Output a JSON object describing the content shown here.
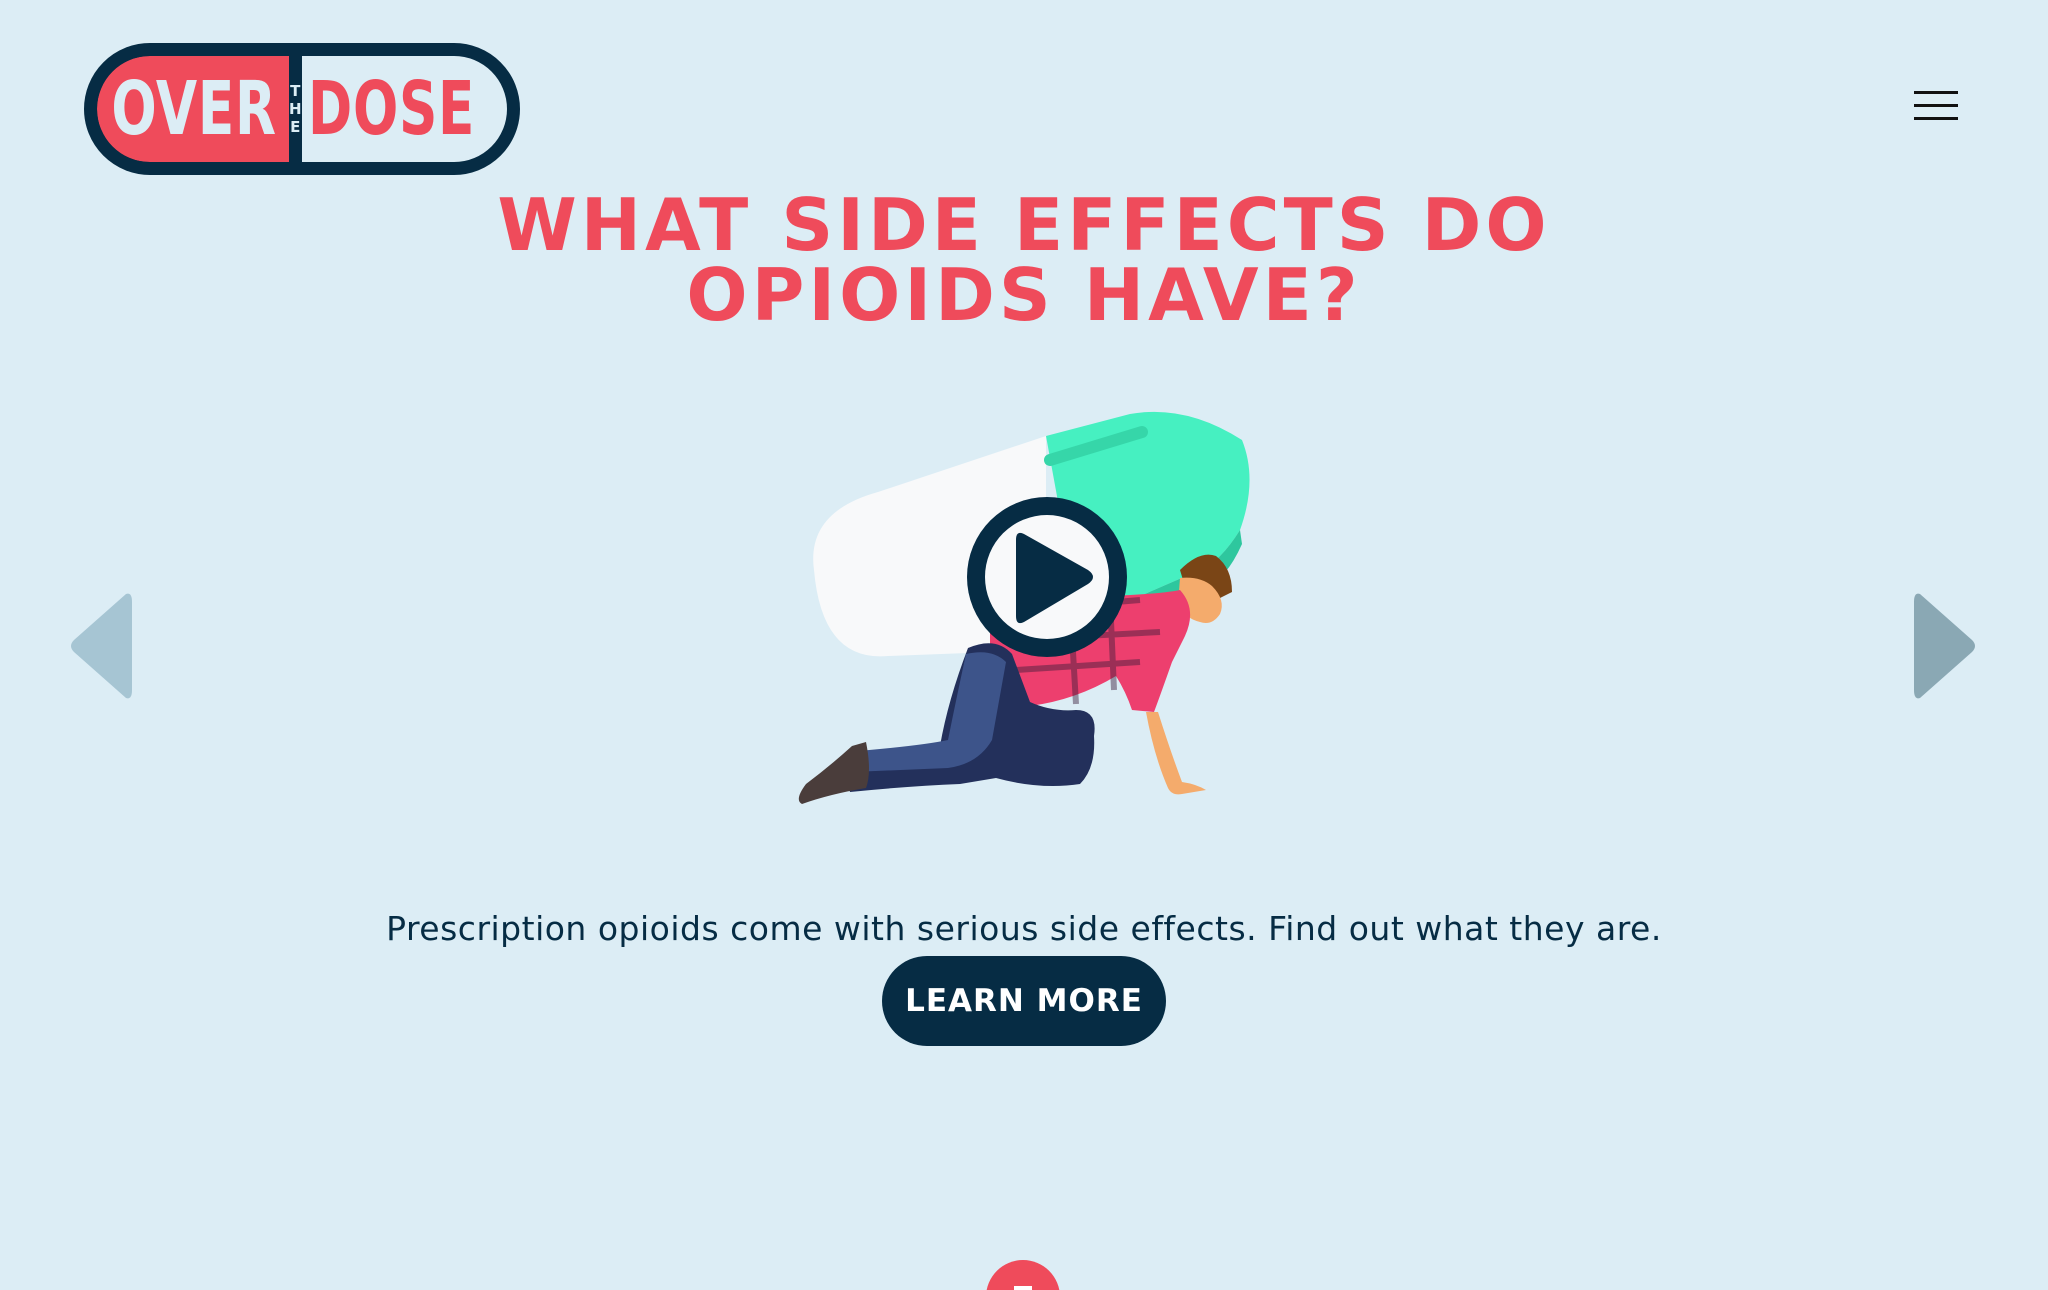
{
  "header": {
    "logo": {
      "left_text": "OVER",
      "middle_letters": [
        "T",
        "H",
        "E"
      ],
      "right_text": "DOSE"
    },
    "menu_icon": "hamburger-menu-icon"
  },
  "slide": {
    "headline_line1": "WHAT SIDE EFFECTS DO",
    "headline_line2": "OPIOIDS HAVE?",
    "video_icon": "play-icon",
    "description": "Prescription opioids come with serious side effects. Find out what they are.",
    "button_label": "LEARN MORE"
  },
  "carousel": {
    "prev_icon": "chevron-left-icon",
    "next_icon": "chevron-right-icon"
  },
  "colors": {
    "background": "#dcedf5",
    "accent_red": "#ef4b5b",
    "navy": "#062c44",
    "pill_teal": "#46f0c1"
  }
}
